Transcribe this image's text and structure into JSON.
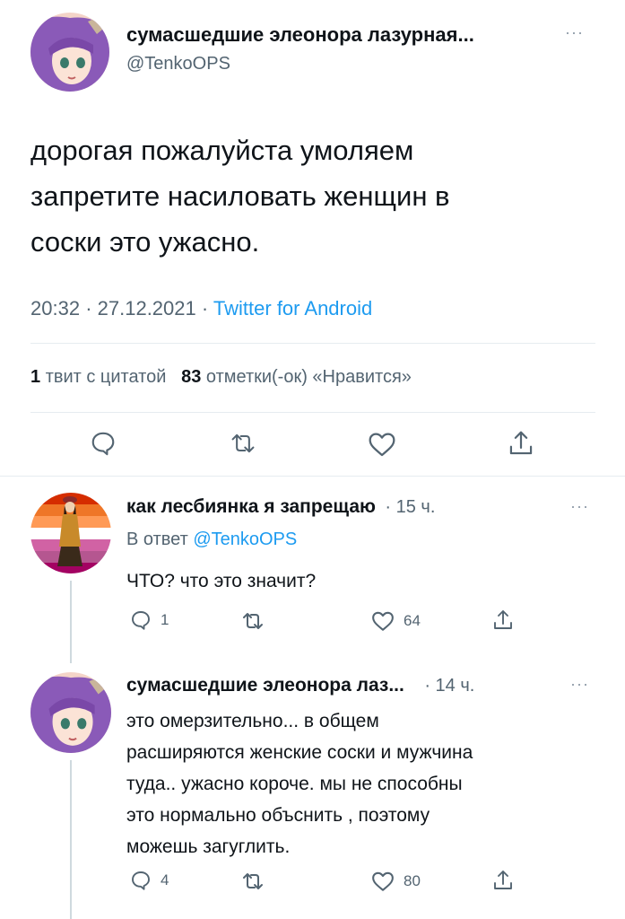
{
  "main_tweet": {
    "display_name": "сумасшедшие элеонора лазурная...",
    "handle": "@TenkoOPS",
    "text_lines": [
      "дорогая пожалуйста умоляем",
      "запретите насиловать женщин в",
      "соски это ужасно."
    ],
    "time": "20:32",
    "date": "27.12.2021",
    "source": "Twitter for Android",
    "separator": "·",
    "stats": {
      "quotes_count": "1",
      "quotes_label": "твит с цитатой",
      "likes_count": "83",
      "likes_label": "отметки(-ок) «Нравится»"
    }
  },
  "replies": [
    {
      "display_name": "как лесбиянка я запрещаю",
      "time": "· 15 ч.",
      "reply_to_label": "В ответ",
      "reply_to_handle": "@TenkoOPS",
      "text_lines": [
        "ЧТО? что это значит?"
      ],
      "reply_count": "1",
      "like_count": "64"
    },
    {
      "display_name": "сумасшедшие элеонора лаз...",
      "time": "· 14 ч.",
      "text_lines": [
        "это омерзительно... в общем",
        "расширяются женские соски и мужчина",
        "туда.. ужасно короче. мы не способны",
        "это нормально объснить , поэтому",
        "можешь загуглить."
      ],
      "reply_count": "4",
      "like_count": "80"
    }
  ],
  "more_label": "···",
  "colors": {
    "accent": "#1d9bf0",
    "text": "#0f1419",
    "muted": "#536471",
    "divider": "#e6ecf0",
    "avatar_purple": "#8a5ab8",
    "flag_stripes": [
      "#d52d00",
      "#ef7627",
      "#ff9a56",
      "#ffffff",
      "#d162a4",
      "#b55690",
      "#a30262"
    ]
  }
}
